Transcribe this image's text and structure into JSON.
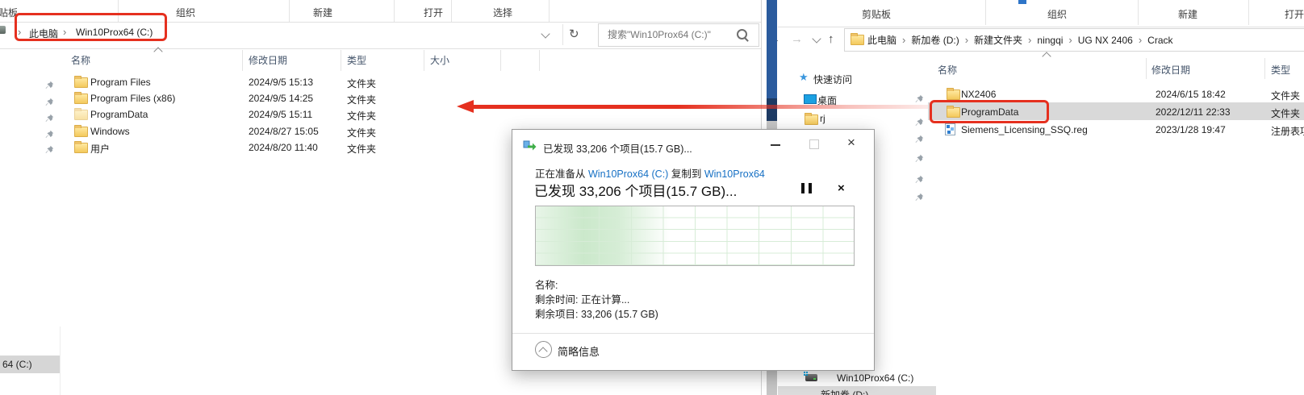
{
  "icons": {
    "back": "←",
    "forward": "→",
    "up": "↑",
    "refresh": "↻",
    "star": "★",
    "close": "×",
    "crumb_separator": "›",
    "minimize": "—"
  },
  "colors": {
    "annotation_red": "#e5301f",
    "link_blue": "#1670c4",
    "strip_blue": "#2b5b9d",
    "strip_navy": "#1d3a63",
    "selection_gray": "#d9d9d9"
  },
  "left_window": {
    "ribbon_groups": [
      "剪贴板",
      "组织",
      "新建",
      "打开",
      "选择"
    ],
    "breadcrumb": {
      "root": "此电脑",
      "current": "Win10Prox64 (C:)"
    },
    "search_placeholder": "搜索\"Win10Prox64 (C:)\"",
    "columns": {
      "name": "名称",
      "date": "修改日期",
      "type": "类型",
      "size": "大小"
    },
    "files": [
      {
        "name": "Program Files",
        "date": "2024/9/5 15:13",
        "type": "文件夹"
      },
      {
        "name": "Program Files (x86)",
        "date": "2024/9/5 14:25",
        "type": "文件夹"
      },
      {
        "name": "ProgramData",
        "date": "2024/9/5 15:11",
        "type": "文件夹"
      },
      {
        "name": "Windows",
        "date": "2024/8/27 15:05",
        "type": "文件夹"
      },
      {
        "name": "用户",
        "date": "2024/8/20 11:40",
        "type": "文件夹"
      }
    ],
    "nav_selected_clipped": "64 (C:)"
  },
  "dialog": {
    "title": "已发现 33,206 个项目(15.7 GB)...",
    "preparing_prefix": "正在准备从",
    "source": "Win10Prox64 (C:)",
    "copy_to": "复制到",
    "destination": "Win10Prox64",
    "headline": "已发现 33,206 个项目(15.7 GB)...",
    "name_label": "名称:",
    "time_remaining": "剩余时间: 正在计算...",
    "items_remaining": "剩余项目: 33,206 (15.7 GB)",
    "footer_toggle": "简略信息"
  },
  "right_window": {
    "ribbon_groups": [
      "剪贴板",
      "组织",
      "新建",
      "打开"
    ],
    "breadcrumb": [
      "此电脑",
      "新加卷 (D:)",
      "新建文件夹",
      "ningqi",
      "UG NX 2406",
      "Crack"
    ],
    "sidebar": {
      "quick_access": "快速访问",
      "desktop": "桌面",
      "folder_rj": "rj",
      "drive_c": "Win10Prox64 (C:)",
      "drive_d_clipped": "新加卷 (D:)"
    },
    "columns": {
      "name": "名称",
      "date": "修改日期",
      "type": "类型"
    },
    "files": [
      {
        "name": "NX2406",
        "date": "2024/6/15 18:42",
        "type": "文件夹"
      },
      {
        "name": "ProgramData",
        "date": "2022/12/11 22:33",
        "type": "文件夹"
      },
      {
        "name": "Siemens_Licensing_SSQ.reg",
        "date": "2023/1/28 19:47",
        "type": "注册表项"
      }
    ]
  }
}
